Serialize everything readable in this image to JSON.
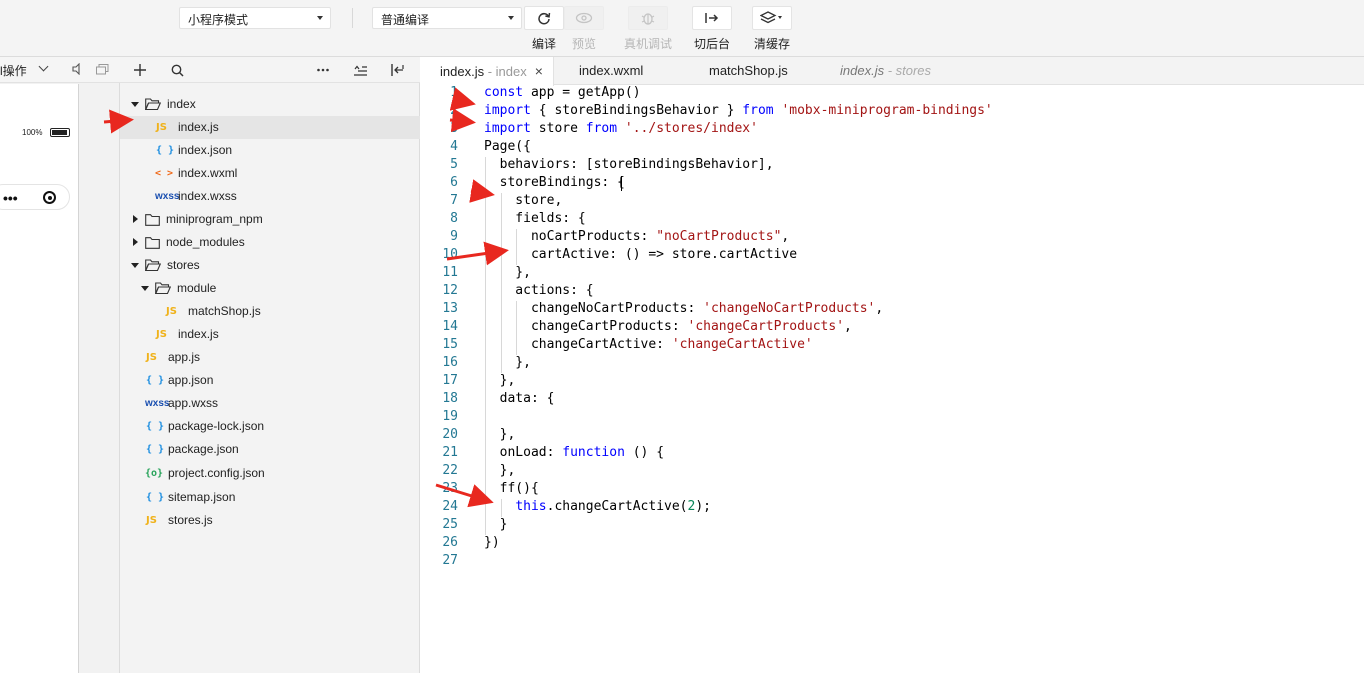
{
  "toolbar": {
    "mode_select": "小程序模式",
    "compile_select": "普通编译",
    "buttons": [
      {
        "label": "编译",
        "icon": "refresh-icon",
        "enabled": true
      },
      {
        "label": "预览",
        "icon": "eye-icon",
        "enabled": false
      },
      {
        "label": "真机调试",
        "icon": "bug-icon",
        "enabled": false
      },
      {
        "label": "切后台",
        "icon": "switch-background-icon",
        "enabled": true
      },
      {
        "label": "清缓存",
        "icon": "layers-icon",
        "enabled": true
      }
    ]
  },
  "simulator": {
    "operation_label": "l操作",
    "battery": "100%"
  },
  "explorer": {
    "tree": [
      {
        "name": "index",
        "type": "folder",
        "expanded": true
      },
      {
        "name": "index.js",
        "type": "js",
        "selected": true
      },
      {
        "name": "index.json",
        "type": "json"
      },
      {
        "name": "index.wxml",
        "type": "wxml"
      },
      {
        "name": "index.wxss",
        "type": "wxss"
      },
      {
        "name": "miniprogram_npm",
        "type": "folder",
        "expanded": false
      },
      {
        "name": "node_modules",
        "type": "folder",
        "expanded": false
      },
      {
        "name": "stores",
        "type": "folder",
        "expanded": true
      },
      {
        "name": "module",
        "type": "folder",
        "expanded": true
      },
      {
        "name": "matchShop.js",
        "type": "js"
      },
      {
        "name": "index.js",
        "type": "js"
      },
      {
        "name": "app.js",
        "type": "js"
      },
      {
        "name": "app.json",
        "type": "json"
      },
      {
        "name": "app.wxss",
        "type": "wxss"
      },
      {
        "name": "package-lock.json",
        "type": "json"
      },
      {
        "name": "package.json",
        "type": "json"
      },
      {
        "name": "project.config.json",
        "type": "config"
      },
      {
        "name": "sitemap.json",
        "type": "json"
      },
      {
        "name": "stores.js",
        "type": "js"
      }
    ],
    "icon_labels": {
      "js": "JS",
      "json": "{ }",
      "wxml": "< >",
      "wxss": "wxss",
      "config": "{o}"
    }
  },
  "editor": {
    "tabs": [
      {
        "title": "index.js",
        "sub": " - index",
        "active": true,
        "close": "×"
      },
      {
        "title": "index.wxml",
        "sub": "",
        "active": false
      },
      {
        "title": "matchShop.js",
        "sub": "",
        "active": false
      },
      {
        "title": "index.js",
        "sub": " - stores",
        "active": false,
        "preview": true
      }
    ],
    "lines": [
      [
        [
          "kw",
          "const"
        ],
        [
          "p",
          " app = getApp()"
        ]
      ],
      [
        [
          "kw",
          "import"
        ],
        [
          "p",
          " { storeBindingsBehavior } "
        ],
        [
          "kw",
          "from"
        ],
        [
          "p",
          " "
        ],
        [
          "str",
          "'mobx-miniprogram-bindings'"
        ]
      ],
      [
        [
          "kw",
          "import"
        ],
        [
          "p",
          " store "
        ],
        [
          "kw",
          "from"
        ],
        [
          "p",
          " "
        ],
        [
          "str",
          "'../stores/index'"
        ]
      ],
      [
        [
          "p",
          "Page({"
        ]
      ],
      [
        [
          "p",
          "  behaviors: [storeBindingsBehavior],"
        ]
      ],
      [
        [
          "p",
          "  storeBindings: {"
        ]
      ],
      [
        [
          "p",
          "    store,"
        ]
      ],
      [
        [
          "p",
          "    fields: {"
        ]
      ],
      [
        [
          "p",
          "      noCartProducts: "
        ],
        [
          "str",
          "\"noCartProducts\""
        ],
        [
          "p",
          ","
        ]
      ],
      [
        [
          "p",
          "      cartActive: () => store.cartActive"
        ]
      ],
      [
        [
          "p",
          "    },"
        ]
      ],
      [
        [
          "p",
          "    actions: {"
        ]
      ],
      [
        [
          "p",
          "      changeNoCartProducts: "
        ],
        [
          "str",
          "'changeNoCartProducts'"
        ],
        [
          "p",
          ","
        ]
      ],
      [
        [
          "p",
          "      changeCartProducts: "
        ],
        [
          "str",
          "'changeCartProducts'"
        ],
        [
          "p",
          ","
        ]
      ],
      [
        [
          "p",
          "      changeCartActive: "
        ],
        [
          "str",
          "'changeCartActive'"
        ]
      ],
      [
        [
          "p",
          "    },"
        ]
      ],
      [
        [
          "p",
          "  },"
        ]
      ],
      [
        [
          "p",
          "  data: {"
        ]
      ],
      [
        [
          "p",
          ""
        ]
      ],
      [
        [
          "p",
          "  },"
        ]
      ],
      [
        [
          "p",
          "  onLoad: "
        ],
        [
          "kw",
          "function"
        ],
        [
          "p",
          " () {"
        ]
      ],
      [
        [
          "p",
          "  },"
        ]
      ],
      [
        [
          "p",
          "  ff(){"
        ]
      ],
      [
        [
          "p",
          "    "
        ],
        [
          "kw",
          "this"
        ],
        [
          "p",
          ".changeCartActive("
        ],
        [
          "num",
          "2"
        ],
        [
          "p",
          ");"
        ]
      ],
      [
        [
          "p",
          "  }"
        ]
      ],
      [
        [
          "p",
          "})"
        ]
      ],
      [
        [
          "p",
          ""
        ]
      ]
    ]
  },
  "colors": {
    "annotation_arrow": "#e8281f",
    "keyword": "#0000ff",
    "string": "#a31515",
    "line_number": "#237893"
  }
}
